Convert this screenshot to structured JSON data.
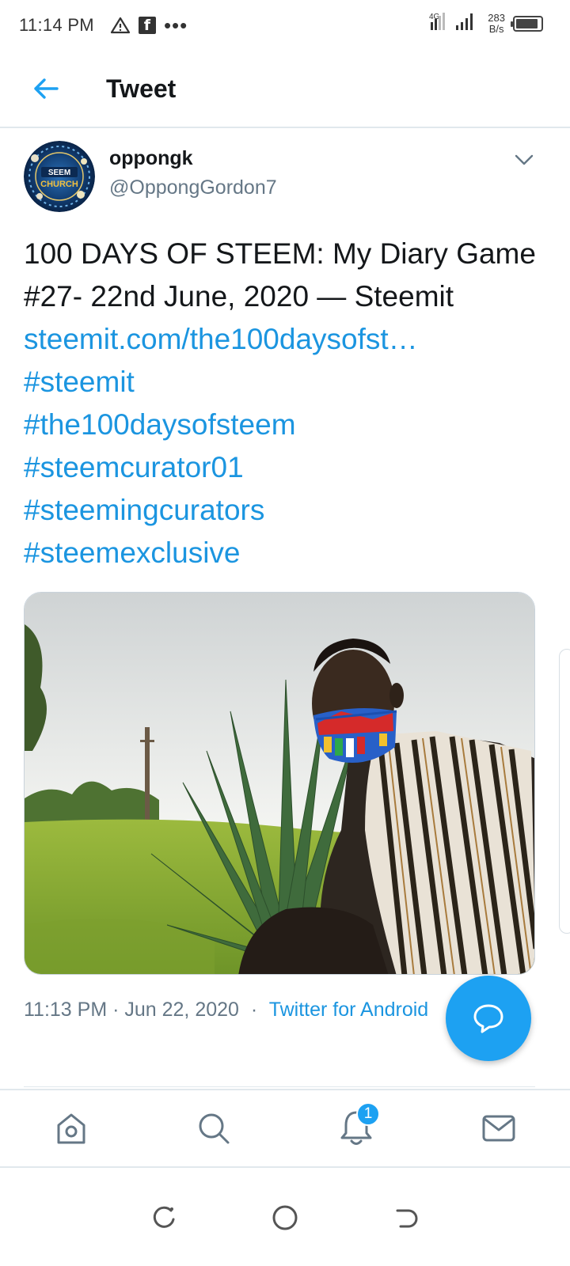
{
  "status_bar": {
    "time": "11:14 PM",
    "network": "4G",
    "speed_value": "283",
    "speed_unit": "B/s",
    "battery_level": 0.9
  },
  "header": {
    "title": "Tweet",
    "back_icon": "arrow-left-icon"
  },
  "tweet": {
    "author": {
      "display_name": "oppongk",
      "handle": "@OppongGordon7",
      "avatar_text": "SEEM CHURCH"
    },
    "text": "100 DAYS OF STEEM: My Diary Game #27- 22nd June, 2020 — Steemit",
    "links": [
      "steemit.com/the100daysofst…",
      "#steemit",
      "#the100daysofsteem",
      "#steemcurator01",
      "#steemingcurators",
      "#steemexclusive"
    ],
    "timestamp": "11:13 PM · Jun 22, 2020",
    "separator": "·",
    "source": "Twitter for Android"
  },
  "fab": {
    "icon": "reply-bubble-icon"
  },
  "bottom_nav": {
    "items": [
      {
        "icon": "home-icon"
      },
      {
        "icon": "search-icon"
      },
      {
        "icon": "notifications-icon",
        "badge": "1"
      },
      {
        "icon": "messages-icon"
      }
    ]
  },
  "system_nav": {
    "items": [
      {
        "icon": "recent-apps-icon"
      },
      {
        "icon": "home-circle-icon"
      },
      {
        "icon": "back-gesture-icon"
      }
    ]
  },
  "colors": {
    "accent": "#1da1f2",
    "link": "#1b95e0",
    "secondary_text": "#657786",
    "primary_text": "#14171a"
  }
}
